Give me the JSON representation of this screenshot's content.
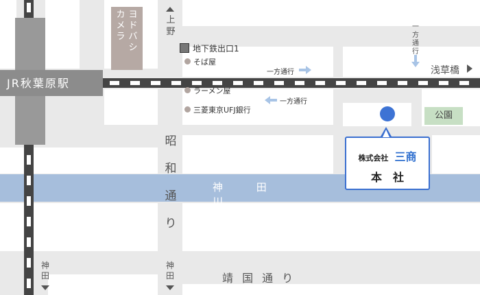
{
  "map": {
    "station": "JR秋葉原駅",
    "building": [
      "ヨドバシ",
      "カメラ"
    ],
    "subway_exit": "地下鉄出口1",
    "pois": [
      "そば屋",
      "ラーメン屋",
      "三菱東京UFJ銀行"
    ],
    "one_way_1": "一方通行",
    "one_way_2": "一方通行",
    "one_way_3": "一方通行",
    "asakusabashi": "浅草橋",
    "park": "公園",
    "river": "神 田 川",
    "showa_dori": "昭和通り",
    "yasukuni_dori": "靖 国 通 り",
    "ueno": "上野",
    "kanda_1": "神田",
    "kanda_2": "神田",
    "company_line1": "株式会社",
    "company_brand": "三商",
    "company_line2": "本　社",
    "colors": {
      "river": "#a6bedc",
      "rail": "#444444",
      "pin": "#3d73d4",
      "park": "#c7dfc4",
      "building": "#b6a9a4",
      "one_way_arrow": "#a8c4e6"
    },
    "icons": [
      "subway-exit-square-icon",
      "poi-dot-icon",
      "one-way-arrow-icon",
      "direction-triangle-icon",
      "location-pin-icon"
    ]
  }
}
